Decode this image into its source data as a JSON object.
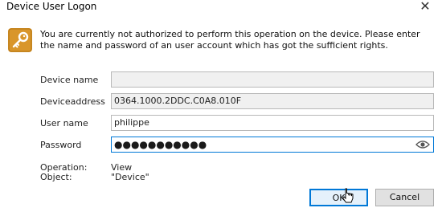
{
  "window": {
    "title": "Device User Logon",
    "close_glyph": "✕"
  },
  "message": "You are currently not authorized to perform this operation on the device. Please enter the name and password of an user account which has got the sufficient rights.",
  "form": {
    "device_name": {
      "label": "Device name",
      "value": ""
    },
    "device_address": {
      "label": "Deviceaddress",
      "value": "0364.1000.2DDC.C0A8.010F"
    },
    "user_name": {
      "label": "User name",
      "value": "philippe"
    },
    "password": {
      "label": "Password",
      "masked_value": "●●●●●●●●●●●"
    }
  },
  "details": {
    "operation_label": "Operation:",
    "operation_value": "View",
    "object_label": "Object:",
    "object_value": "\"Device\""
  },
  "buttons": {
    "ok": "OK",
    "cancel": "Cancel"
  },
  "colors": {
    "accent": "#0078d7",
    "icon": "#d9962b"
  }
}
